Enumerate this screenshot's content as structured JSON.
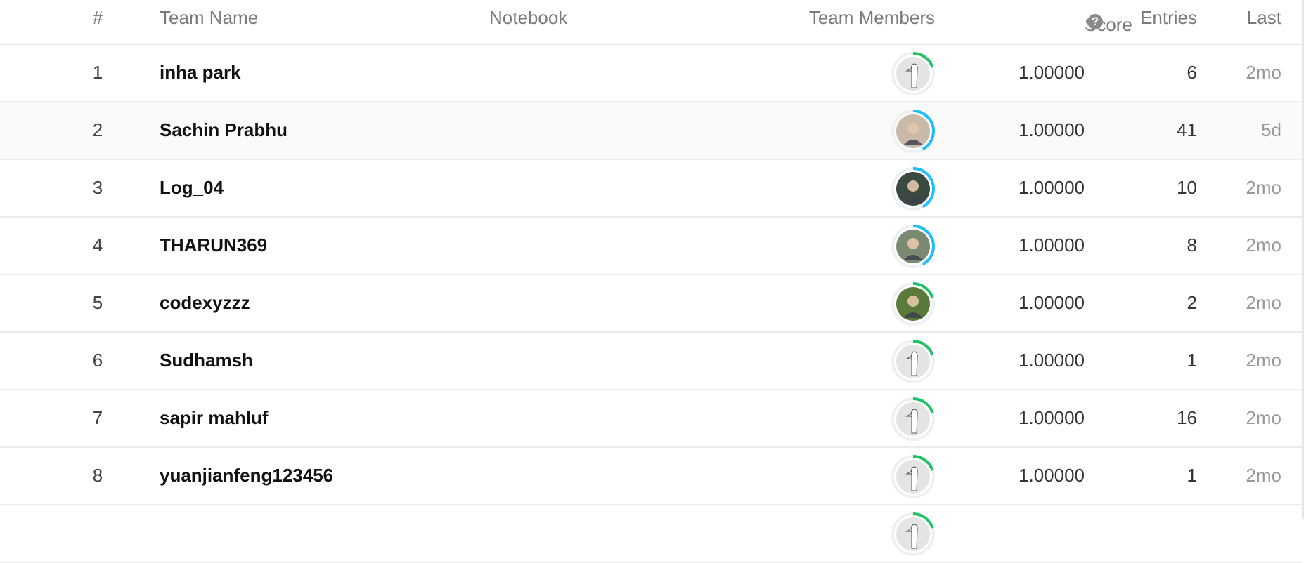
{
  "header": {
    "rank": "#",
    "team_name": "Team Name",
    "notebook": "Notebook",
    "team_members": "Team Members",
    "score": "Score",
    "score_help_icon": "?",
    "entries": "Entries",
    "last": "Last"
  },
  "colors": {
    "green_tier": "#20c265",
    "blue_tier": "#20beff",
    "ring_track": "#eef0f2"
  },
  "rows": [
    {
      "rank": "1",
      "team": "inha park",
      "score": "1.00000",
      "entries": "6",
      "last": "2mo",
      "tier": "green",
      "avatar": "goose"
    },
    {
      "rank": "2",
      "team": "Sachin Prabhu",
      "score": "1.00000",
      "entries": "41",
      "last": "5d",
      "tier": "blue",
      "avatar": "photo"
    },
    {
      "rank": "3",
      "team": "Log_04",
      "score": "1.00000",
      "entries": "10",
      "last": "2mo",
      "tier": "blue",
      "avatar": "photo"
    },
    {
      "rank": "4",
      "team": "THARUN369",
      "score": "1.00000",
      "entries": "8",
      "last": "2mo",
      "tier": "blue",
      "avatar": "photo"
    },
    {
      "rank": "5",
      "team": "codexyzzz",
      "score": "1.00000",
      "entries": "2",
      "last": "2mo",
      "tier": "green",
      "avatar": "photo"
    },
    {
      "rank": "6",
      "team": "Sudhamsh",
      "score": "1.00000",
      "entries": "1",
      "last": "2mo",
      "tier": "green",
      "avatar": "goose"
    },
    {
      "rank": "7",
      "team": "sapir mahluf",
      "score": "1.00000",
      "entries": "16",
      "last": "2mo",
      "tier": "green",
      "avatar": "goose"
    },
    {
      "rank": "8",
      "team": "yuanjianfeng123456",
      "score": "1.00000",
      "entries": "1",
      "last": "2mo",
      "tier": "green",
      "avatar": "goose"
    }
  ]
}
